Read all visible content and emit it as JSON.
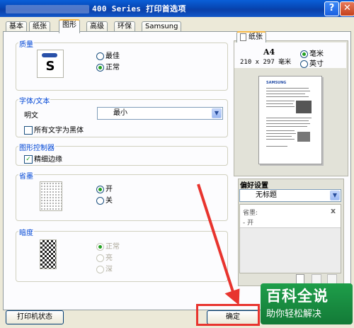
{
  "window": {
    "title_suffix": "400 Series 打印首选项",
    "help_label": "?",
    "close_label": "✕"
  },
  "tabs": [
    "基本",
    "纸张",
    "图形",
    "高级",
    "环保",
    "Samsung"
  ],
  "active_tab": "图形",
  "quality": {
    "label": "质量",
    "icon_letter": "S",
    "options": [
      "最佳",
      "正常"
    ],
    "selected": "正常"
  },
  "font_text": {
    "label": "字体/文本",
    "field_label": "明文",
    "select_value": "最小",
    "checkbox_label": "所有文字为黑体",
    "checked": false
  },
  "graphic_controller": {
    "label": "图形控制器",
    "checkbox_label": "精细边缘",
    "checked": true
  },
  "toner_save": {
    "label": "省墨",
    "options": [
      "开",
      "关"
    ],
    "selected": "开"
  },
  "darkness": {
    "label": "暗度",
    "options": [
      "正常",
      "亮",
      "深"
    ],
    "selected": "正常",
    "disabled": true
  },
  "preview": {
    "tab_label": "纸张",
    "paper_size": "A4",
    "paper_dims": "210 x 297 毫米",
    "units": [
      "毫米",
      "英寸"
    ],
    "selected_unit": "毫米",
    "page_logo_text": "SAMSUNG"
  },
  "favorites": {
    "label": "偏好设置",
    "select_value": "无标题",
    "summary_title": "省墨:",
    "summary_value": "- 开",
    "close_label": "x"
  },
  "buttons": {
    "printer_status": "打印机状态",
    "ok": "确定"
  },
  "watermark": {
    "line1": "百科全说",
    "line2": "助你轻松解决"
  },
  "colors": {
    "titlebar": "#0747b5",
    "group_label": "#0046d5",
    "highlight_red": "#e8342e",
    "radio_on": "#21a121"
  }
}
